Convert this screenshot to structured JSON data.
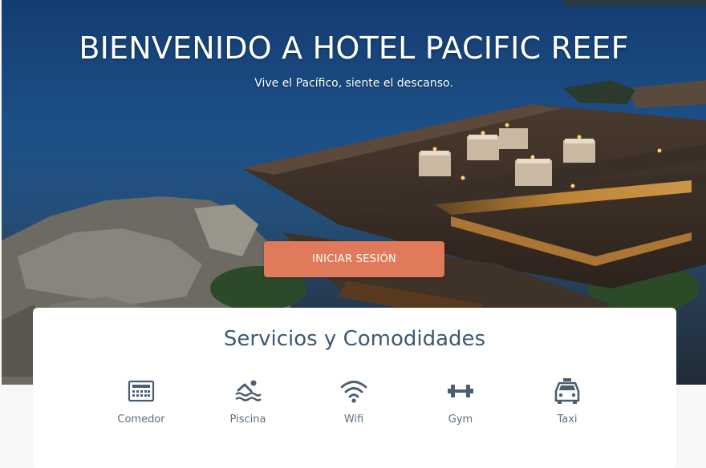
{
  "hero": {
    "title": "BIENVENIDO A HOTEL PACIFIC REEF",
    "subtitle": "Vive el Pacífico, siente el descanso.",
    "login_label": "INICIAR SESIÓN"
  },
  "services": {
    "title": "Servicios y Comodidades",
    "items": [
      {
        "label": "Comedor",
        "icon": "restaurant-icon"
      },
      {
        "label": "Piscina",
        "icon": "pool-icon"
      },
      {
        "label": "Wifi",
        "icon": "wifi-icon"
      },
      {
        "label": "Gym",
        "icon": "dumbbell-icon"
      },
      {
        "label": "Taxi",
        "icon": "taxi-icon"
      }
    ]
  },
  "colors": {
    "accent": "#e07a5a",
    "heading": "#3d5a73",
    "icon": "#4a5f73"
  }
}
